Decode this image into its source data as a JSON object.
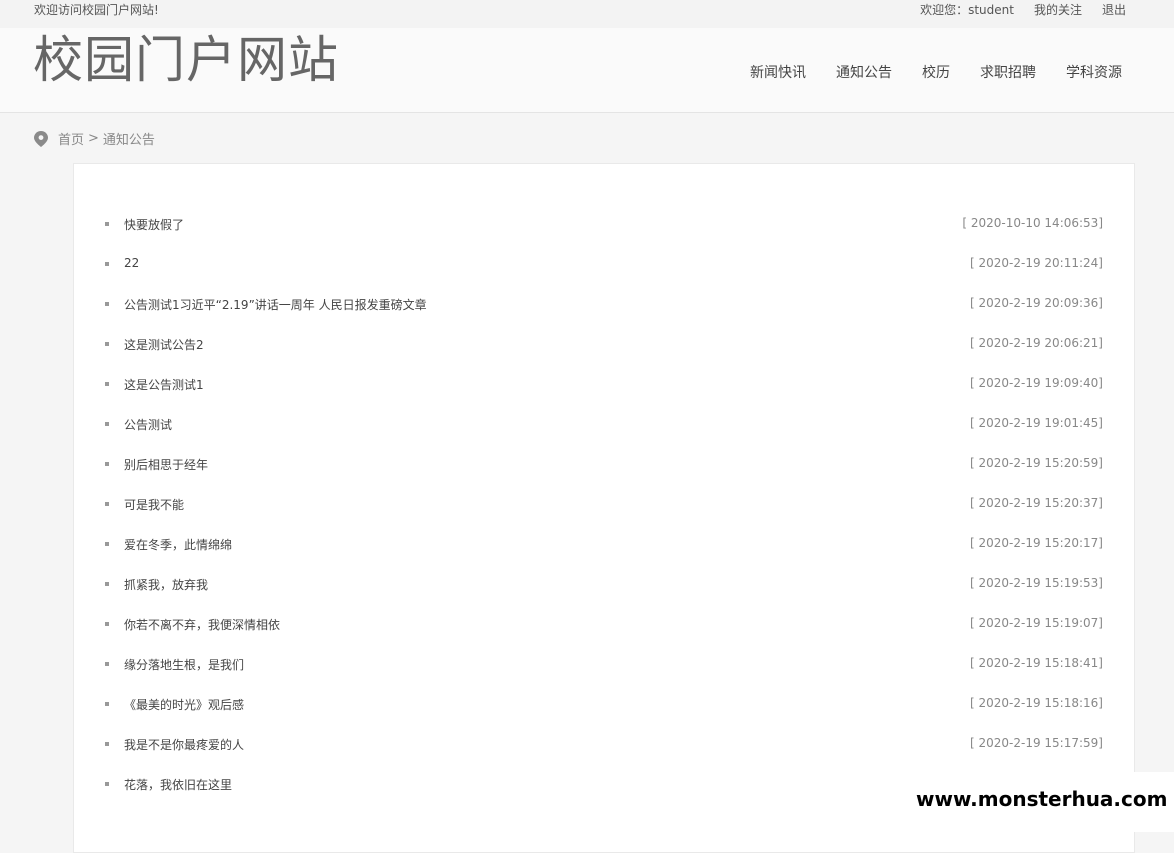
{
  "topbar": {
    "welcome": "欢迎访问校园门户网站!",
    "user_greeting": "欢迎您：student",
    "my_follow": "我的关注",
    "logout": "退出"
  },
  "header": {
    "logo": "校园门户网站",
    "nav": [
      "新闻快讯",
      "通知公告",
      "校历",
      "求职招聘",
      "学科资源"
    ]
  },
  "breadcrumb": {
    "home": "首页",
    "separator": ">",
    "current": "通知公告"
  },
  "notices": [
    {
      "title": "快要放假了",
      "time": "[ 2020-10-10 14:06:53]"
    },
    {
      "title": "22",
      "time": "[ 2020-2-19 20:11:24]"
    },
    {
      "title": "公告测试1习近平“2.19”讲话一周年 人民日报发重磅文章",
      "time": "[ 2020-2-19 20:09:36]"
    },
    {
      "title": "这是测试公告2",
      "time": "[ 2020-2-19 20:06:21]"
    },
    {
      "title": "这是公告测试1",
      "time": "[ 2020-2-19 19:09:40]"
    },
    {
      "title": "公告测试",
      "time": "[ 2020-2-19 19:01:45]"
    },
    {
      "title": "别后相思于经年",
      "time": "[ 2020-2-19 15:20:59]"
    },
    {
      "title": "可是我不能",
      "time": "[ 2020-2-19 15:20:37]"
    },
    {
      "title": "爱在冬季，此情绵绵",
      "time": "[ 2020-2-19 15:20:17]"
    },
    {
      "title": "抓紧我，放弃我",
      "time": "[ 2020-2-19 15:19:53]"
    },
    {
      "title": "你若不离不弃，我便深情相依",
      "time": "[ 2020-2-19 15:19:07]"
    },
    {
      "title": "缘分落地生根，是我们",
      "time": "[ 2020-2-19 15:18:41]"
    },
    {
      "title": "《最美的时光》观后感",
      "time": "[ 2020-2-19 15:18:16]"
    },
    {
      "title": "我是不是你最疼爱的人",
      "time": "[ 2020-2-19 15:17:59]"
    },
    {
      "title": "花落，我依旧在这里",
      "time": ""
    }
  ],
  "watermark": "www.monsterhua.com",
  "colors": {
    "page_bg": "#f5f5f5",
    "panel_bg": "#ffffff",
    "text": "#444444",
    "muted": "#888888"
  }
}
